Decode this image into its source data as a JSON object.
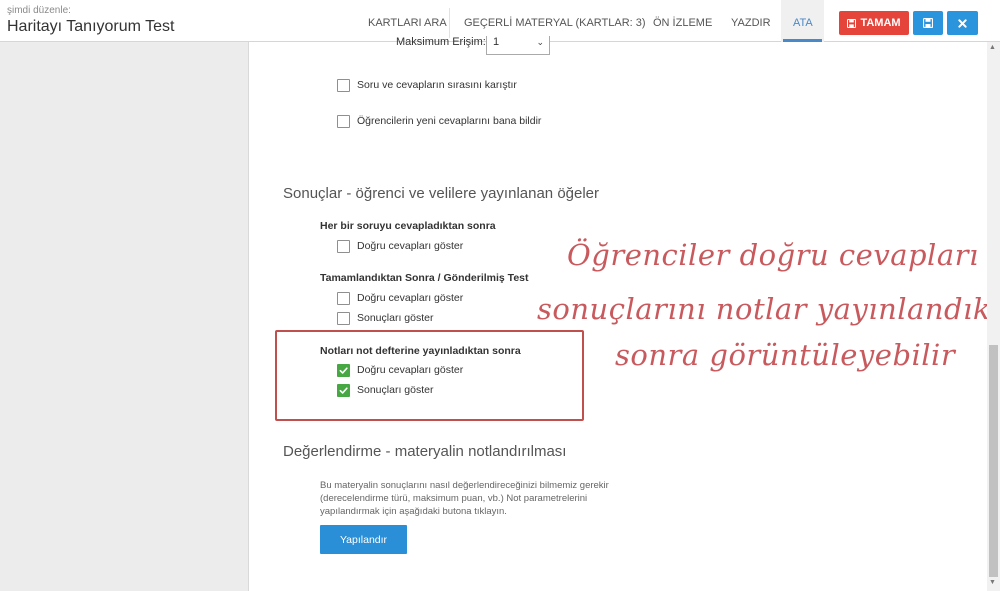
{
  "header": {
    "editing_label": "şimdi düzenle:",
    "title": "Haritayı Tanıyorum Test"
  },
  "nav": {
    "tabs": [
      {
        "label": "KARTLARI ARA"
      },
      {
        "label": "GEÇERLİ MATERYAL (KARTLAR: 3)"
      },
      {
        "label": "ÖN İZLEME"
      },
      {
        "label": "YAZDIR"
      },
      {
        "label": "ATA"
      }
    ],
    "active_tab": "ATA"
  },
  "actions": {
    "done_label": "TAMAM",
    "done_icon": "save-icon",
    "save_icon": "save-icon",
    "close_icon": "close-icon"
  },
  "colors": {
    "accent": "#4a89c8",
    "danger": "#e5443b",
    "primary": "#2a94dc",
    "checked": "#46a743",
    "highlight": "#c0504d",
    "annotation": "#c85a5e"
  },
  "settings": {
    "max_attempts_label": "Maksimum Erişim:",
    "max_attempts_value": "1",
    "shuffle_label": "Soru ve cevapların sırasını karıştır",
    "shuffle_checked": false,
    "notify_label": "Öğrencilerin yeni cevaplarını bana bildir",
    "notify_checked": false
  },
  "results": {
    "title": "Sonuçlar - öğrenci ve velilere yayınlanan öğeler",
    "groups": [
      {
        "title": "Her bir soruyu cevapladıktan sonra",
        "options": [
          {
            "label": "Doğru cevapları göster",
            "checked": false
          }
        ]
      },
      {
        "title": "Tamamlandıktan Sonra / Gönderilmiş Test",
        "options": [
          {
            "label": "Doğru cevapları göster",
            "checked": false
          },
          {
            "label": "Sonuçları göster",
            "checked": false
          }
        ]
      },
      {
        "title": "Notları not defterine yayınladıktan sonra",
        "options": [
          {
            "label": "Doğru cevapları göster",
            "checked": true
          },
          {
            "label": "Sonuçları göster",
            "checked": true
          }
        ]
      }
    ]
  },
  "grading": {
    "title": "Değerlendirme - materyalin notlandırılması",
    "description": "Bu materyalin sonuçlarını nasıl değerlendireceğinizi bilmemiz gerekir (derecelendirme türü, maksimum puan, vb.) Not parametrelerini yapılandırmak için aşağıdaki butona tıklayın.",
    "configure_label": "Yapılandır"
  },
  "annotation": {
    "line1": "Öğrenciler doğru cevapları ve",
    "line2": "sonuçlarını notlar yayınlandıktan",
    "line3": "sonra görüntüleyebilir"
  }
}
